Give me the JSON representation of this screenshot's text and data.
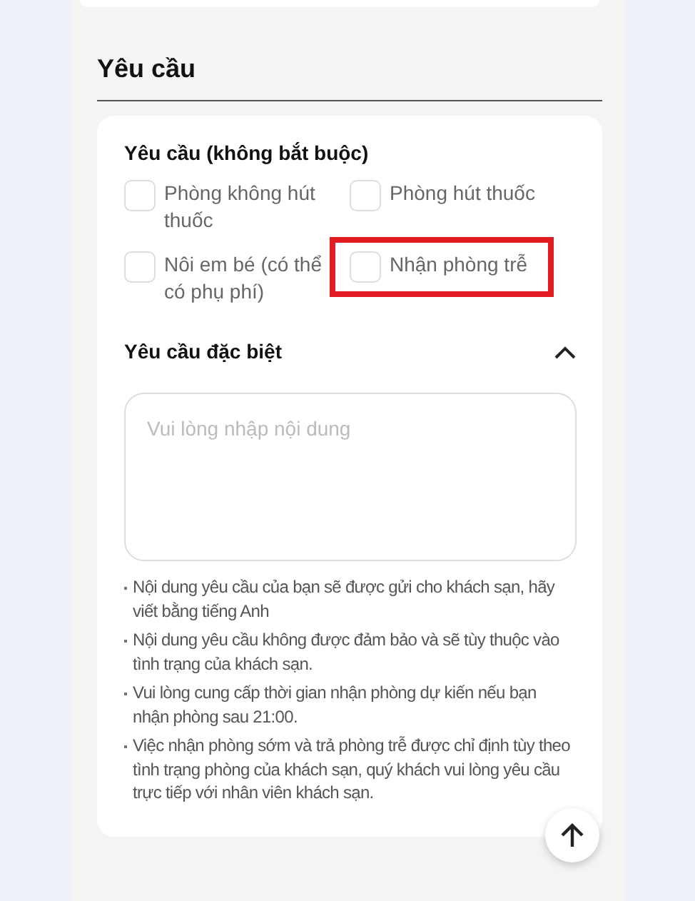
{
  "section_title": "Yêu cầu",
  "requests": {
    "title": "Yêu cầu (không bắt buộc)",
    "options": [
      {
        "label": "Phòng không hút thuốc",
        "checked": false,
        "highlighted": false
      },
      {
        "label": "Phòng hút thuốc",
        "checked": false,
        "highlighted": false
      },
      {
        "label": "Nôi em bé (có thể có phụ phí)",
        "checked": false,
        "highlighted": false
      },
      {
        "label": "Nhận phòng trễ",
        "checked": false,
        "highlighted": true
      }
    ]
  },
  "special": {
    "title": "Yêu cầu đặc biệt",
    "expanded": true,
    "placeholder": "Vui lòng nhập nội dung",
    "notes": [
      "Nội dung yêu cầu của bạn sẽ được gửi cho khách sạn, hãy viết bằng tiếng Anh",
      "Nội dung yêu cầu không được đảm bảo và sẽ tùy thuộc vào tình trạng của khách sạn.",
      "Vui lòng cung cấp thời gian nhận phòng dự kiến nếu bạn nhận phòng sau 21:00.",
      "Việc nhận phòng sớm và trả phòng trễ được chỉ định tùy theo tình trạng phòng của khách sạn, quý khách vui lòng yêu cầu trực tiếp với nhân viên khách sạn."
    ]
  }
}
